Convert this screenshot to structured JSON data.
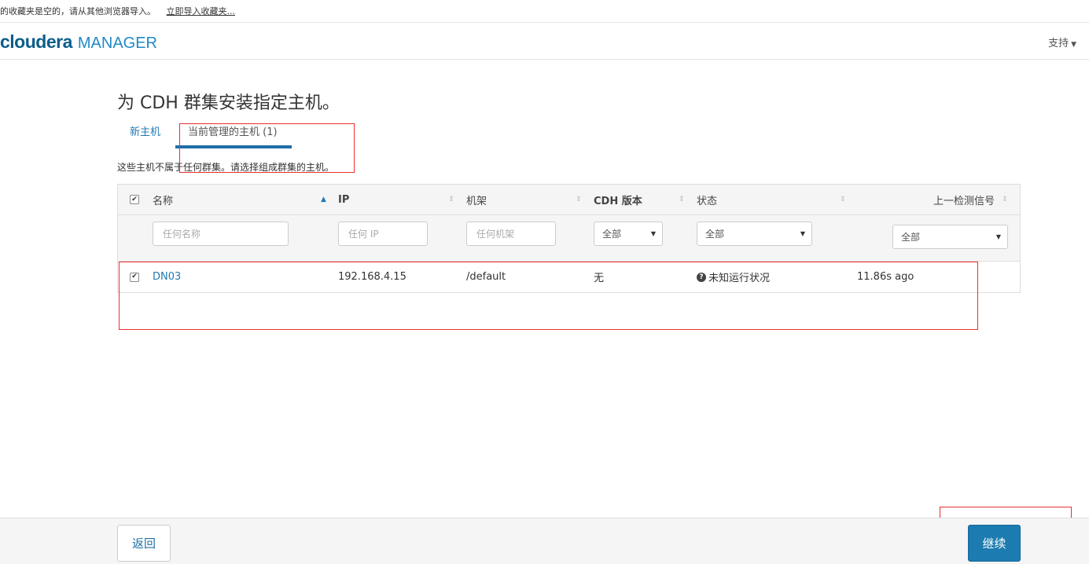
{
  "bookmark_bar": {
    "message": "的收藏夹是空的，请从其他浏览器导入。",
    "import_link": "立即导入收藏夹..."
  },
  "header": {
    "logo_cloudera": "cloudera",
    "logo_manager": "MANAGER",
    "support": "支持"
  },
  "page": {
    "title": "为 CDH 群集安装指定主机。",
    "tabs": [
      {
        "label": "新主机",
        "active": false
      },
      {
        "label": "当前管理的主机 (1)",
        "active": true
      }
    ],
    "description": "这些主机不属于任何群集。请选择组成群集的主机。"
  },
  "table": {
    "columns": {
      "name": "名称",
      "ip": "IP",
      "rack": "机架",
      "cdh_version": "CDH 版本",
      "status": "状态",
      "last_heartbeat": "上一检测信号"
    },
    "filters": {
      "name_placeholder": "任何名称",
      "ip_placeholder": "任何 IP",
      "rack_placeholder": "任何机架",
      "cdh_version_selected": "全部",
      "status_selected": "全部",
      "last_heartbeat_selected": "全部"
    },
    "rows": [
      {
        "checked": true,
        "name": "DN03",
        "ip": "192.168.4.15",
        "rack": "/default",
        "cdh_version": "无",
        "status": "未知运行状况",
        "last_heartbeat": "11.86s ago"
      }
    ]
  },
  "footer": {
    "back": "返回",
    "continue": "继续"
  },
  "colors": {
    "brand_dark": "#0b5d8c",
    "brand_light": "#1f8ac7",
    "link": "#1f7ab3",
    "primary_button": "#1c7bb0",
    "annotation_red": "#e8302f"
  }
}
